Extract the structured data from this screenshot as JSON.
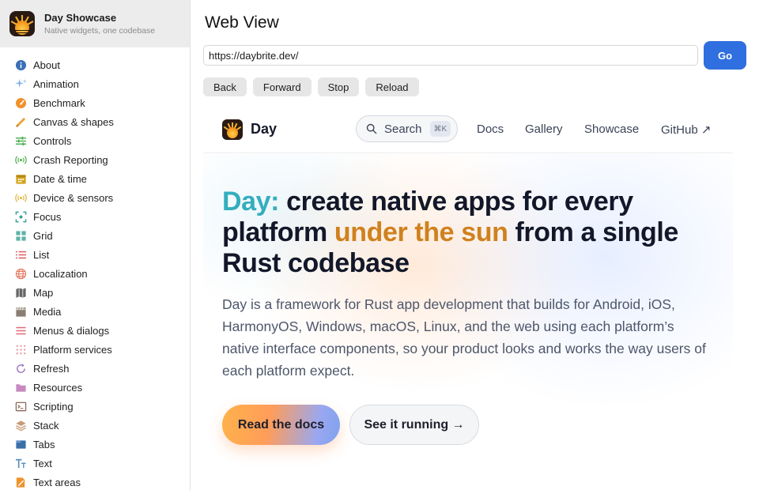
{
  "app": {
    "title": "Day Showcase",
    "subtitle": "Native widgets, one codebase"
  },
  "sidebar": {
    "items": [
      {
        "label": "About",
        "icon": "info-icon",
        "color": "#3b6fb6"
      },
      {
        "label": "Animation",
        "icon": "sparkles-icon",
        "color": "#7fb0e6"
      },
      {
        "label": "Benchmark",
        "icon": "gauge-icon",
        "color": "#f0922b"
      },
      {
        "label": "Canvas & shapes",
        "icon": "pencil-icon",
        "color": "#e9a23b"
      },
      {
        "label": "Controls",
        "icon": "sliders-icon",
        "color": "#4caf50"
      },
      {
        "label": "Crash Reporting",
        "icon": "broadcast-icon",
        "color": "#4caf50"
      },
      {
        "label": "Date & time",
        "icon": "calendar-icon",
        "color": "#d4a21a"
      },
      {
        "label": "Device & sensors",
        "icon": "signal-icon",
        "color": "#e0b43c"
      },
      {
        "label": "Focus",
        "icon": "focus-icon",
        "color": "#3aa39a"
      },
      {
        "label": "Grid",
        "icon": "grid-icon",
        "color": "#5db3a8"
      },
      {
        "label": "List",
        "icon": "list-icon",
        "color": "#e05a5a"
      },
      {
        "label": "Localization",
        "icon": "globe-icon",
        "color": "#e57a63"
      },
      {
        "label": "Map",
        "icon": "map-icon",
        "color": "#666666"
      },
      {
        "label": "Media",
        "icon": "clapper-icon",
        "color": "#8a7e72"
      },
      {
        "label": "Menus & dialogs",
        "icon": "menu-icon",
        "color": "#e06a78"
      },
      {
        "label": "Platform services",
        "icon": "dots-grid-icon",
        "color": "#e8a0a8"
      },
      {
        "label": "Refresh",
        "icon": "refresh-icon",
        "color": "#9a72c0"
      },
      {
        "label": "Resources",
        "icon": "folder-icon",
        "color": "#c789c0"
      },
      {
        "label": "Scripting",
        "icon": "terminal-icon",
        "color": "#8a6a5a"
      },
      {
        "label": "Stack",
        "icon": "layers-icon",
        "color": "#c79a78"
      },
      {
        "label": "Tabs",
        "icon": "tabs-icon",
        "color": "#3a6ea8"
      },
      {
        "label": "Text",
        "icon": "text-icon",
        "color": "#5a8fc0"
      },
      {
        "label": "Text areas",
        "icon": "edit-doc-icon",
        "color": "#f0922b"
      }
    ]
  },
  "main": {
    "title": "Web View",
    "url": "https://daybrite.dev/",
    "go_label": "Go",
    "buttons": {
      "back": "Back",
      "forward": "Forward",
      "stop": "Stop",
      "reload": "Reload"
    }
  },
  "site": {
    "name": "Day",
    "search_label": "Search",
    "search_shortcut": "⌘K",
    "links": {
      "docs": "Docs",
      "gallery": "Gallery",
      "showcase": "Showcase",
      "github": "GitHub ↗"
    },
    "hero": {
      "title_teal": "Day:",
      "title_part1": " create native apps for every platform ",
      "title_amber": "under the sun",
      "title_part2": " from a single Rust codebase",
      "description": "Day is a framework for Rust app development that builds for Android, iOS, HarmonyOS, Windows, macOS, Linux, and the web using each platform’s native interface components, so your product looks and works the way users of each platform expect.",
      "cta_primary": "Read the docs",
      "cta_secondary": "See it running →"
    }
  },
  "colors": {
    "accent": "#2f6fe0",
    "hero_teal": "#33aebd",
    "hero_amber": "#d0811d",
    "sidebar_header_bg": "#ececec"
  }
}
